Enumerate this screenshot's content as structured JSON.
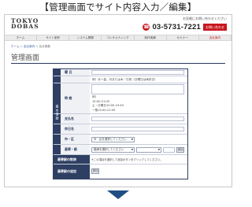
{
  "heading": "【管理画面でサイト内容入力／編集】",
  "site": {
    "logo_lines": [
      "TOKYO",
      "DOBAS"
    ],
    "contact_note": "お気軽にお問い合わせください",
    "phone": "03-5731-7221",
    "contact_button": "お問い合わせ",
    "nav": [
      {
        "label": "ホーム"
      },
      {
        "label": "サイト制作"
      },
      {
        "label": "システム開発"
      },
      {
        "label": "コンサルティング"
      },
      {
        "label": "制作実績"
      },
      {
        "label": "セミナー"
      },
      {
        "label": "会社案内",
        "active": true
      }
    ],
    "breadcrumb": {
      "home": "ホーム",
      "sep1": " > ",
      "link": "会社案内",
      "sep2": " > ",
      "current": "会社概要"
    },
    "page_title": "管理画面"
  },
  "form": {
    "sidebar_label": "基本情報",
    "rows": {
      "day": {
        "label": "曜 日",
        "value": ""
      },
      "hours": {
        "label": "時 間",
        "placeholder": "例）月〜金、月または木／日祝（日曜日は休診日）"
      },
      "hours_text": {
        "value": "例）\n10:00-21:00\n土・日曜日10:00-19:45\n一般10:00-21:00"
      },
      "payment": {
        "label": "支払名",
        "value": ""
      },
      "holiday": {
        "label": "休日名",
        "value": ""
      },
      "area": {
        "label": "市・区",
        "select": "市・区を選択してください"
      },
      "station": {
        "label": "最寄・駅",
        "select": "路線を選択してください",
        "button": "追加"
      },
      "station_note": {
        "label": "最寄駅の削除",
        "note": "※この項目を選択して追加ボタンをクリックしてください。"
      },
      "add_station": {
        "label": "最寄駅の追加",
        "button": "追加"
      }
    }
  },
  "colors": {
    "accent": "#c8161e",
    "navy": "#2e3f63",
    "arrow": "#1f4e84"
  }
}
